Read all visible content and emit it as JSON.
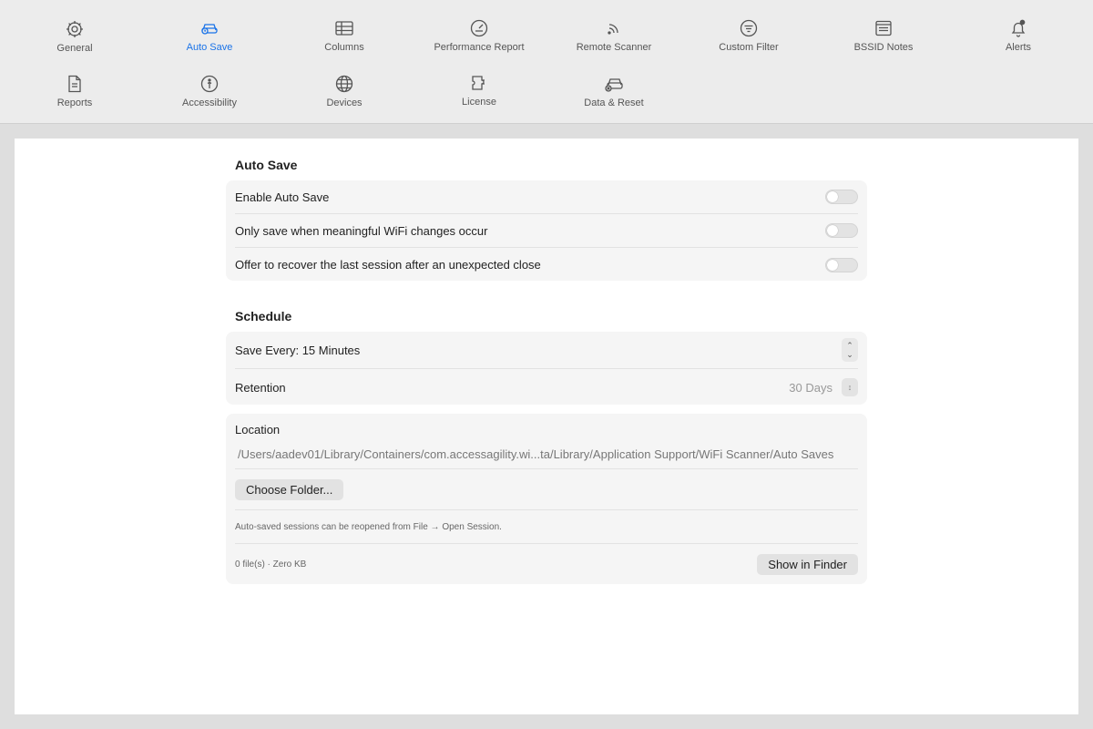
{
  "toolbar": {
    "items": [
      {
        "label": "General",
        "icon": "gear-icon"
      },
      {
        "label": "Auto Save",
        "icon": "car-clock-icon",
        "active": true
      },
      {
        "label": "Columns",
        "icon": "table-icon"
      },
      {
        "label": "Performance Report",
        "icon": "gauge-icon"
      },
      {
        "label": "Remote Scanner",
        "icon": "signal-icon"
      },
      {
        "label": "Custom Filter",
        "icon": "filter-icon"
      },
      {
        "label": "BSSID Notes",
        "icon": "notes-icon"
      },
      {
        "label": "Alerts",
        "icon": "bell-icon"
      },
      {
        "label": "Reports",
        "icon": "document-icon"
      },
      {
        "label": "Accessibility",
        "icon": "accessibility-icon"
      },
      {
        "label": "Devices",
        "icon": "globe-icon"
      },
      {
        "label": "License",
        "icon": "puzzle-icon"
      },
      {
        "label": "Data & Reset",
        "icon": "drive-reset-icon"
      }
    ],
    "accent_color": "#1a73e8"
  },
  "auto_save": {
    "title": "Auto Save",
    "rows": [
      {
        "label": "Enable Auto Save",
        "on": false
      },
      {
        "label": "Only save when meaningful WiFi changes occur",
        "on": false
      },
      {
        "label": "Offer to recover the last session after an unexpected close",
        "on": false
      }
    ]
  },
  "schedule": {
    "title": "Schedule",
    "save_every": "Save Every: 15 Minutes",
    "retention_label": "Retention",
    "retention_value": "30 Days"
  },
  "location": {
    "label": "Location",
    "path": "/Users/aadev01/Library/Containers/com.accessagility.wi...ta/Library/Application Support/WiFi Scanner/Auto Saves",
    "choose_button": "Choose Folder...",
    "hint": "Auto-saved sessions can be reopened from File → Open Session.",
    "stats": "0 file(s) · Zero KB",
    "finder_button": "Show in Finder"
  }
}
